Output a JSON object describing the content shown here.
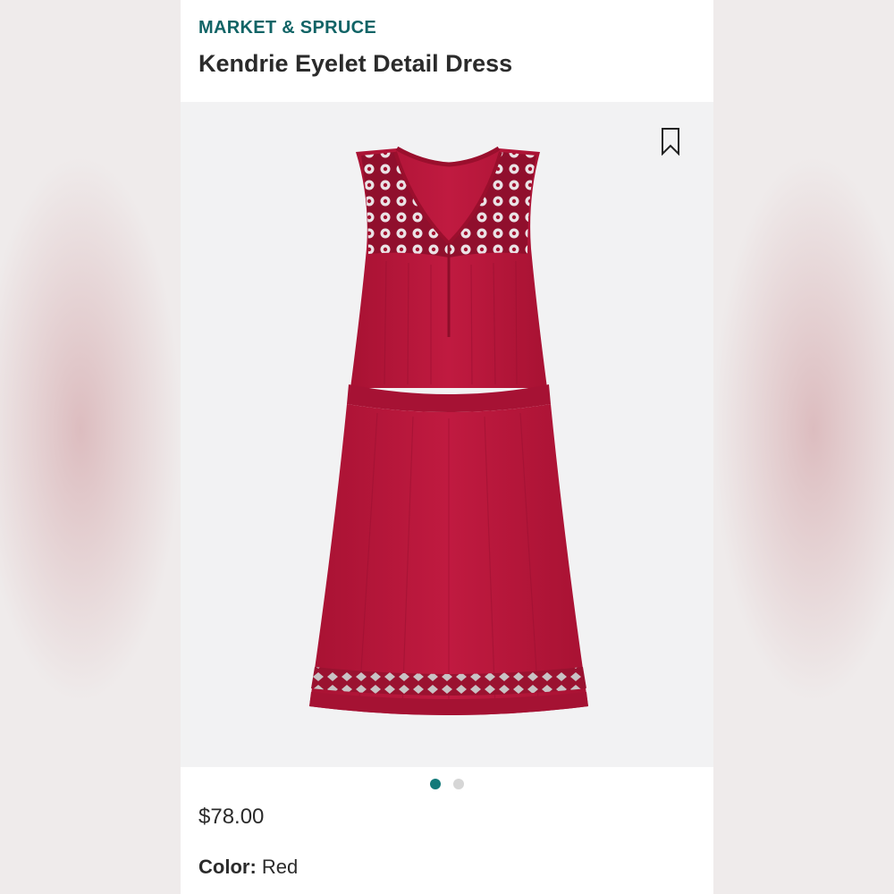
{
  "product": {
    "brand": "MARKET & SPRUCE",
    "name": "Kendrie Eyelet Detail Dress",
    "price": "$78.00",
    "color_label": "Color:",
    "color_value": "Red"
  },
  "gallery": {
    "image_count": 2,
    "active_index": 0,
    "dress_color": "#b8163a"
  },
  "colors": {
    "brand_teal": "#116466",
    "active_dot": "#137a7a",
    "inactive_dot": "#d6d6d6"
  },
  "icons": {
    "bookmark": "bookmark-icon"
  }
}
